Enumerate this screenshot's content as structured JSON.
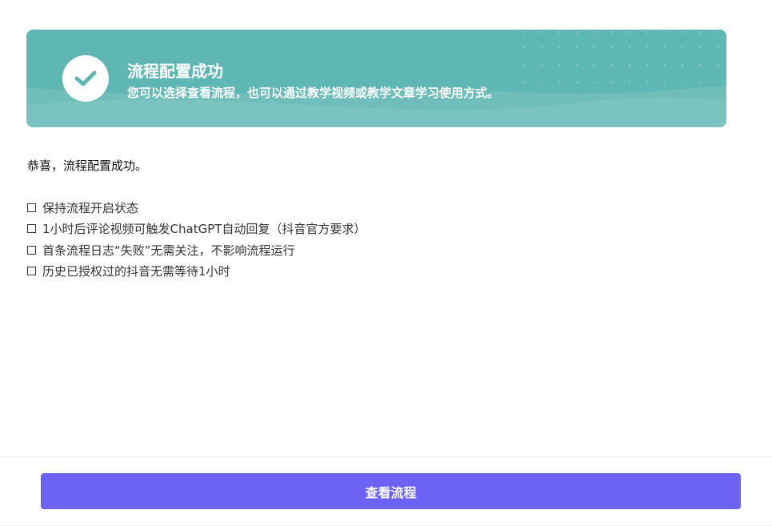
{
  "banner": {
    "title": "流程配置成功",
    "subtitle": "您可以选择查看流程，也可以通过教学视频或教学文章学习使用方式。",
    "icon": "check-icon",
    "bg_color": "#5fb7b3"
  },
  "message": "恭喜，流程配置成功。",
  "checklist": [
    {
      "label": "保持流程开启状态",
      "checked": false
    },
    {
      "label": "1小时后评论视频可触发ChatGPT自动回复（抖音官方要求）",
      "checked": false
    },
    {
      "label": "首条流程日志“失败”无需关注，不影响流程运行",
      "checked": false
    },
    {
      "label": "历史已授权过的抖音无需等待1小时",
      "checked": false
    }
  ],
  "footer": {
    "button_label": "查看流程",
    "button_color": "#6c63f6"
  }
}
